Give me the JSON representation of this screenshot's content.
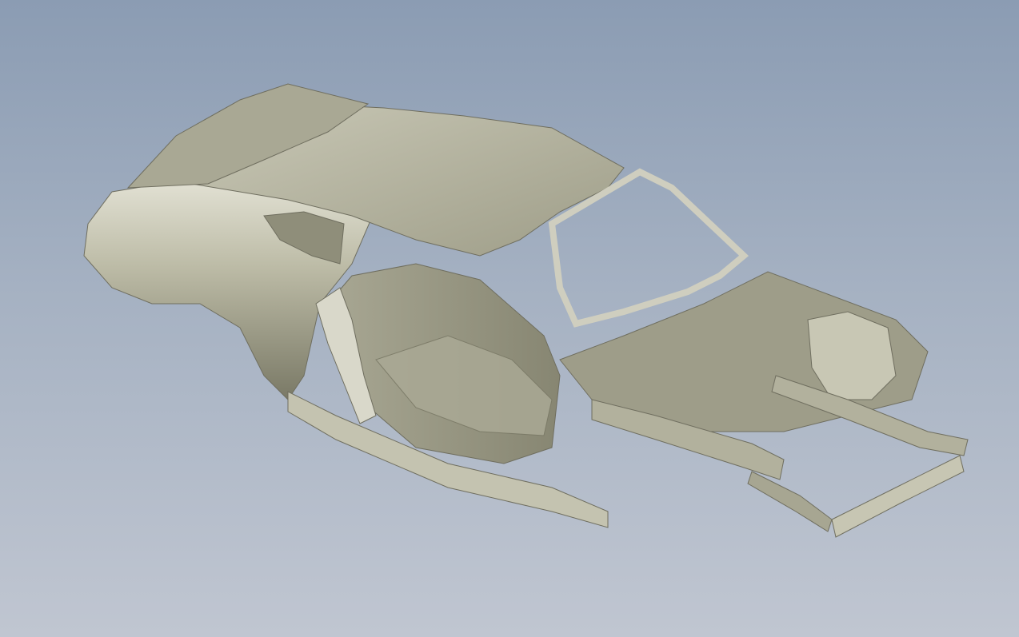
{
  "viewport": {
    "background_top": "#8b9cb3",
    "background_bottom": "#c0c6d1"
  },
  "model": {
    "subject": "car-body-in-white-scan",
    "material_color": "#b9b8a4",
    "highlight_color": "#e8e8dc",
    "shadow_color": "#6f6e5f"
  }
}
